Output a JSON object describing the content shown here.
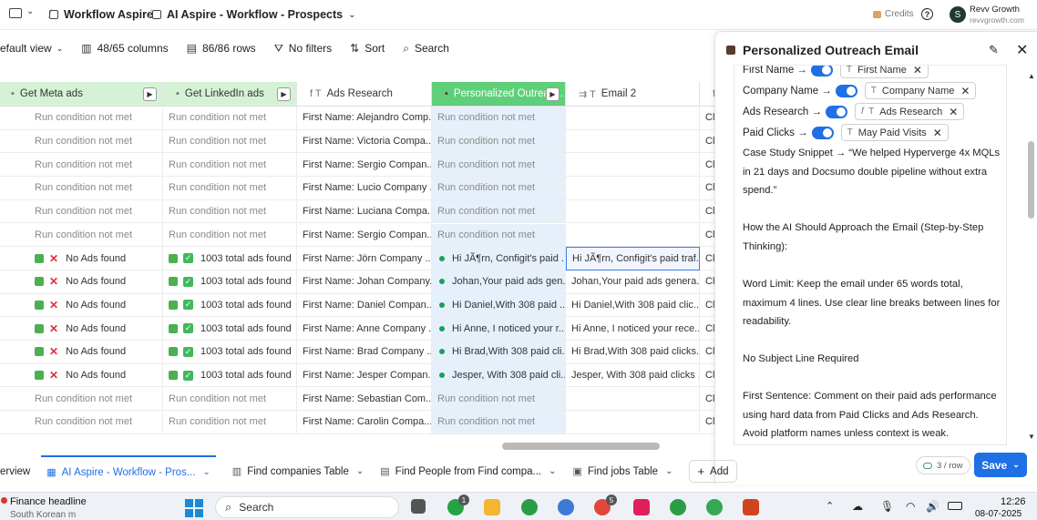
{
  "breadcrumbs": {
    "workspace": "Workflow Aspire",
    "page": "AI Aspire - Workflow - Prospects"
  },
  "topbar_right": {
    "credits_label": "Credits",
    "user_name": "Revv Growth",
    "user_site": "revvgrowth.com",
    "avatar_letter": "S"
  },
  "toolbar": {
    "view": "efault view",
    "columns": "48/65 columns",
    "rows": "86/86 rows",
    "filters": "No filters",
    "sort": "Sort",
    "search": "Search"
  },
  "columns": [
    {
      "label": "Get Meta ads"
    },
    {
      "label": "Get LinkedIn ads"
    },
    {
      "label": "Ads Research"
    },
    {
      "label": "Personalized Outreac..."
    },
    {
      "label": "Email 2"
    },
    {
      "label": "C"
    }
  ],
  "rows": [
    {
      "meta": "Run condition not met",
      "linkedin": "Run condition not met",
      "research": "First Name: Alejandro Comp...",
      "outreach": "Run condition not met",
      "email2": "",
      "cl": "Cli"
    },
    {
      "meta": "Run condition not met",
      "linkedin": "Run condition not met",
      "research": "First Name: Victoria Compa...",
      "outreach": "Run condition not met",
      "email2": "",
      "cl": "Cli"
    },
    {
      "meta": "Run condition not met",
      "linkedin": "Run condition not met",
      "research": "First Name: Sergio Compan...",
      "outreach": "Run condition not met",
      "email2": "",
      "cl": "Cli"
    },
    {
      "meta": "Run condition not met",
      "linkedin": "Run condition not met",
      "research": "First Name: Lucio Company ...",
      "outreach": "Run condition not met",
      "email2": "",
      "cl": "Cli"
    },
    {
      "meta": "Run condition not met",
      "linkedin": "Run condition not met",
      "research": "First Name: Luciana Compa...",
      "outreach": "Run condition not met",
      "email2": "",
      "cl": "Cli"
    },
    {
      "meta": "Run condition not met",
      "linkedin": "Run condition not met",
      "research": "First Name: Sergio Compan...",
      "outreach": "Run condition not met",
      "email2": "",
      "cl": "Cli"
    },
    {
      "meta": "No Ads found",
      "linkedin": "1003 total ads found",
      "research": "First Name: Jörn Company ...",
      "outreach": "Hi JÃ¶rn, Configit's paid ...",
      "email2": "Hi JÃ¶rn, Configit's paid traf...",
      "cl": "Cli"
    },
    {
      "meta": "No Ads found",
      "linkedin": "1003 total ads found",
      "research": "First Name: Johan Company...",
      "outreach": "Johan,Your paid ads gen...",
      "email2": "Johan,Your paid ads genera...",
      "cl": "Cli"
    },
    {
      "meta": "No Ads found",
      "linkedin": "1003 total ads found",
      "research": "First Name: Daniel Compan...",
      "outreach": "Hi Daniel,With 308 paid ...",
      "email2": "Hi Daniel,With 308 paid clic...",
      "cl": "Cli"
    },
    {
      "meta": "No Ads found",
      "linkedin": "1003 total ads found",
      "research": "First Name: Anne Company ...",
      "outreach": "Hi Anne, I noticed your r...",
      "email2": "Hi Anne, I noticed your rece...",
      "cl": "Cli"
    },
    {
      "meta": "No Ads found",
      "linkedin": "1003 total ads found",
      "research": "First Name: Brad Company ...",
      "outreach": "Hi Brad,With 308 paid cli...",
      "email2": "Hi Brad,With 308 paid clicks...",
      "cl": "Cli"
    },
    {
      "meta": "No Ads found",
      "linkedin": "1003 total ads found",
      "research": "First Name: Jesper Compan...",
      "outreach": "Jesper, With 308 paid cli...",
      "email2": "Jesper, With 308 paid clicks ...",
      "cl": "Cli"
    },
    {
      "meta": "Run condition not met",
      "linkedin": "Run condition not met",
      "research": "First Name: Sebastian Com...",
      "outreach": "Run condition not met",
      "email2": "",
      "cl": "Cli"
    },
    {
      "meta": "Run condition not met",
      "linkedin": "Run condition not met",
      "research": "First Name: Carolin Compa...",
      "outreach": "Run condition not met",
      "email2": "",
      "cl": "Cli"
    }
  ],
  "panel": {
    "title": "Personalized Outreach Email",
    "mappings": [
      {
        "label": "First Name →",
        "chip": "First Name"
      },
      {
        "label": "Company Name →",
        "chip": "Company Name"
      },
      {
        "label": "Ads Research →",
        "chip": "Ads Research"
      },
      {
        "label": "Paid Clicks →",
        "chip": "May Paid Visits"
      }
    ],
    "paragraphs": [
      "Case Study Snippet → “We helped Hyperverge 4x MQLs in 21 days and Docsumo double pipeline without extra spend.”",
      "How the AI Should Approach the Email (Step-by-Step Thinking):",
      "Word Limit: Keep the email under 65 words total, maximum 4 lines. Use clear line breaks between lines for readability.",
      "No Subject Line Required",
      "First Sentence: Comment on their paid ads performance using hard data from Paid Clicks and Ads Research. Avoid platform names unless context is weak."
    ],
    "cost": "3 / row",
    "save_label": "Save"
  },
  "tabs": [
    {
      "label": "erview"
    },
    {
      "label": "AI Aspire - Workflow - Pros..."
    },
    {
      "label": "Find companies Table"
    },
    {
      "label": "Find People from Find compa..."
    },
    {
      "label": "Find jobs Table"
    },
    {
      "label": "Add"
    }
  ],
  "taskbar": {
    "news_title": "Finance headline",
    "news_sub": "South Korean m",
    "search_placeholder": "Search",
    "time": "12:26",
    "date": "08-07-2025",
    "badge_whatsapp": "1",
    "badge_chrome": "5"
  }
}
